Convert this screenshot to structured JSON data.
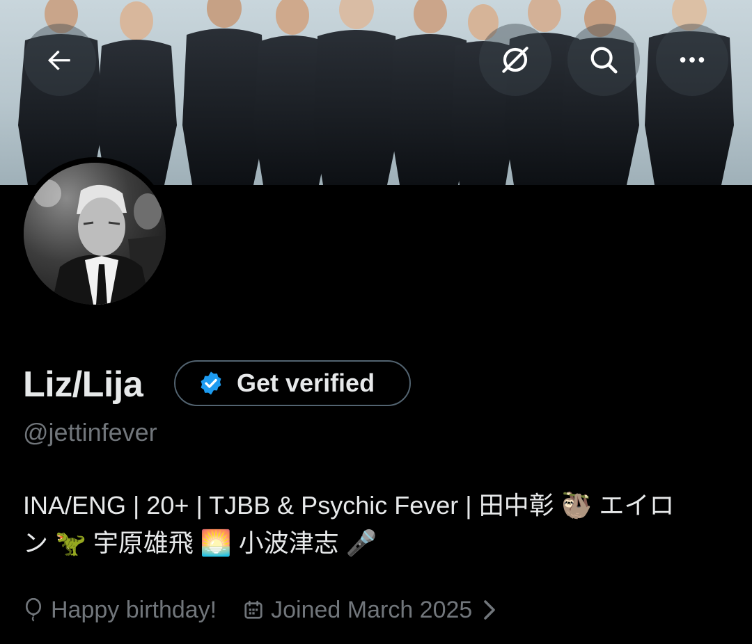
{
  "header": {
    "back_icon": "arrow-left-icon",
    "translate_icon": "translate-slash-icon",
    "search_icon": "search-icon",
    "more_icon": "more-horizontal-icon"
  },
  "profile": {
    "display_name": "Liz/Lija",
    "handle": "@jettinfever",
    "get_verified_label": "Get verified",
    "verified_badge_color": "#1d9bf0",
    "bio_line1": "INA/ENG | 20+ | TJBB & Psychic Fever | 田中彰 🦥 エイロ",
    "bio_line2": "ン 🦖 宇原雄飛 🌅 小波津志 🎤",
    "birthday_text": "Happy birthday!",
    "joined_text": "Joined March 2025"
  },
  "colors": {
    "background": "#000000",
    "primary_text": "#e7e9ea",
    "secondary_text": "#71767b",
    "border": "#536471"
  }
}
